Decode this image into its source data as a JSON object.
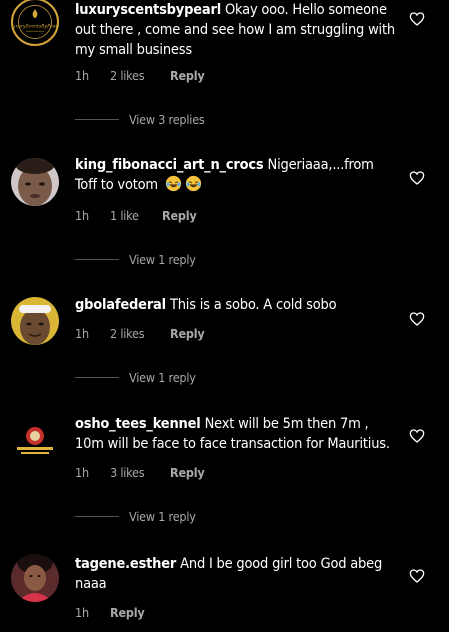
{
  "comments": [
    {
      "username": "luxuryscentsbypearl",
      "text": "Okay ooo. Hello someone out there , come and see how I am struggling with my small business",
      "time": "1h",
      "likes": "2 likes",
      "reply": "Reply",
      "view_replies": "View 3 replies",
      "avatar_logo_text": "luxuryScentsByPearl"
    },
    {
      "username": "king_fibonacci_art_n_crocs",
      "text": "Nigeriaaa,...from Toff to votom",
      "emoji": "😂😂",
      "time": "1h",
      "likes": "1 like",
      "reply": "Reply",
      "view_replies": "View 1 reply"
    },
    {
      "username": "gbolafederal",
      "text": "This is a sobo. A cold sobo",
      "time": "1h",
      "likes": "2 likes",
      "reply": "Reply",
      "view_replies": "View 1 reply"
    },
    {
      "username": "osho_tees_kennel",
      "text": "Next will be 5m then 7m , 10m will be face to face transaction for Mauritius.",
      "time": "1h",
      "likes": "3 likes",
      "reply": "Reply",
      "view_replies": "View 1 reply"
    },
    {
      "username": "tagene.esther",
      "text": "And I be good girl too God abeg naaa",
      "time": "1h",
      "reply": "Reply"
    }
  ],
  "icons": {
    "like": "heart-outline-icon",
    "emoji": "face-with-tears-of-joy"
  },
  "colors": {
    "background": "#000000",
    "text": "#ffffff",
    "secondary": "#a8a8a8",
    "logo_gold": "#d4a63a"
  }
}
